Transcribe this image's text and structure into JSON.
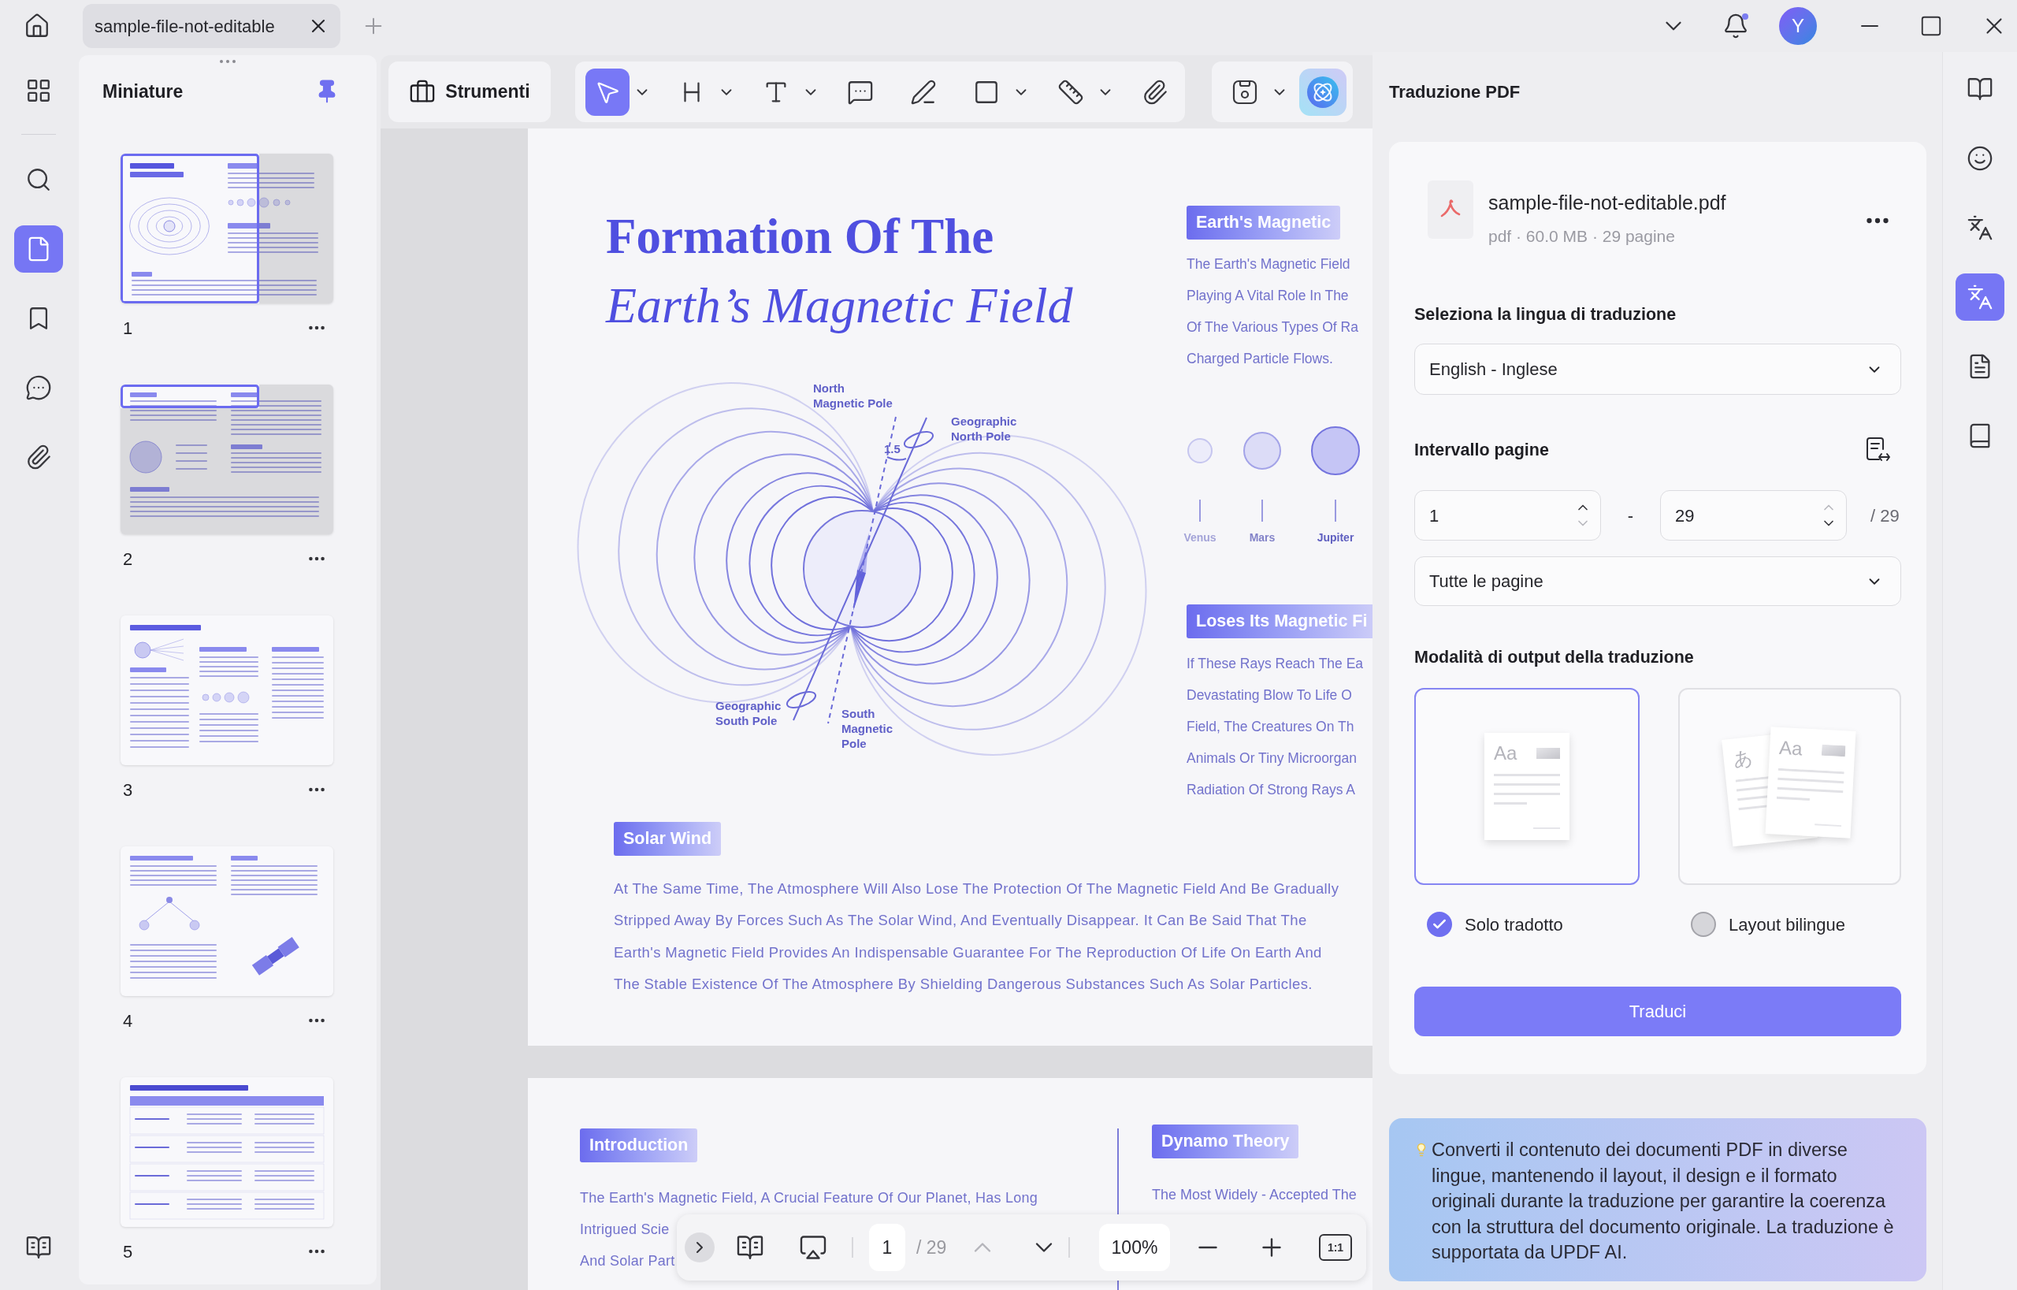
{
  "title_bar": {
    "tabs": [
      {
        "label": "sample-file-not-editable",
        "selected": true
      }
    ],
    "unread": true,
    "avatar_initial": "Y"
  },
  "left_rail": {
    "items": [
      {
        "selected": false
      },
      {
        "selected": false
      },
      {
        "selected": true
      },
      {
        "selected": false
      },
      {
        "selected": false
      },
      {
        "selected": false
      }
    ]
  },
  "thumbnails": {
    "title": "Miniature",
    "pinned": true,
    "pages": [
      {
        "number": "1",
        "kind": "cover",
        "in_view": true,
        "fully_in_view": true
      },
      {
        "number": "2",
        "kind": "columns",
        "in_view": true,
        "fully_in_view": false
      },
      {
        "number": "3",
        "kind": "theories",
        "in_view": false,
        "fully_in_view": false
      },
      {
        "number": "4",
        "kind": "satellite",
        "in_view": false,
        "fully_in_view": false
      },
      {
        "number": "5",
        "kind": "table",
        "in_view": false,
        "fully_in_view": false
      }
    ]
  },
  "toolbar": {
    "tools_label": "Strumenti",
    "tools": [
      {
        "selected": true,
        "dropdown": true
      },
      {
        "selected": false,
        "dropdown": true
      },
      {
        "selected": false,
        "dropdown": true
      },
      {
        "selected": false,
        "dropdown": false
      },
      {
        "selected": false,
        "dropdown": false
      },
      {
        "selected": false,
        "dropdown": true
      },
      {
        "selected": false,
        "dropdown": true
      },
      {
        "selected": false,
        "dropdown": false
      }
    ],
    "extra_tools": [
      {
        "dropdown": true
      },
      {
        "dropdown": false
      }
    ]
  },
  "document": {
    "page_1": {
      "title_lines": [
        "Formation Of The",
        "Earth’s Magnetic Field"
      ],
      "diagram_labels": [
        {
          "lines": [
            "North",
            "Magnetic Pole"
          ]
        },
        {
          "lines": [
            "Geographic",
            "North Pole"
          ]
        },
        {
          "lines": [
            "1.5"
          ]
        },
        {
          "lines": [
            "Geographic",
            "South Pole"
          ]
        },
        {
          "lines": [
            "South",
            "Magnetic",
            "Pole"
          ]
        }
      ],
      "side_sections": [
        {
          "heading": "Earth's Magnetic",
          "lines": [
            "The Earth's Magnetic Field",
            "Playing A Vital Role In The",
            "Of The Various Types Of Ra",
            "Charged Particle Flows."
          ]
        },
        {
          "heading": "Loses Its Magnetic Fi",
          "lines": [
            "If These Rays Reach The Ea",
            "Devastating Blow To Life O",
            "Field, The Creatures On Th",
            "Animals Or Tiny Microorgan",
            "Radiation Of Strong Rays A"
          ]
        }
      ],
      "planets": [
        "Venus",
        "Mars",
        "Jupiter"
      ],
      "solar_wind": {
        "heading": "Solar Wind",
        "text": "At The Same Time, The Atmosphere Will Also Lose The Protection Of The Magnetic Field And Be Gradually Stripped Away By Forces Such As The Solar Wind, And Eventually Disappear. It Can Be Said That The Earth's Magnetic Field Provides An Indispensable Guarantee For The Reproduction Of Life On Earth And The Stable Existence Of The Atmosphere By Shielding Dangerous Substances Such As Solar Particles."
      }
    },
    "page_2": {
      "sections": [
        {
          "heading": "Introduction",
          "lines": [
            "The Earth's Magnetic Field, A Crucial Feature Of Our Planet, Has Long",
            "Intrigued Scie",
            "And Solar Part"
          ]
        },
        {
          "heading": "Dynamo Theory",
          "lines": [
            "The Most Widely - Accepted The"
          ]
        }
      ]
    }
  },
  "bottom_toolbar": {
    "page": "1",
    "total": "/ 29",
    "prev_disabled": true,
    "next_disabled": false,
    "zoom": "100%",
    "actual_size": "1:1"
  },
  "translation_panel": {
    "title": "Traduzione PDF",
    "file": {
      "name": "sample-file-not-editable.pdf",
      "meta": "pdf · 60.0 MB · 29 pagine"
    },
    "language": {
      "label": "Seleziona la lingua di traduzione",
      "value": "English - Inglese"
    },
    "range": {
      "label": "Intervallo pagine",
      "from": {
        "value": "1",
        "up_disabled": false,
        "down_disabled": true
      },
      "separator": "-",
      "to": {
        "value": "29",
        "up_disabled": true,
        "down_disabled": false
      },
      "total": "/ 29",
      "preset": "Tutte le pagine"
    },
    "output": {
      "label": "Modalità di output della traduzione",
      "options": [
        {
          "label": "Solo tradotto",
          "selected": true,
          "kind": "single",
          "preview": [
            "Aa"
          ]
        },
        {
          "label": "Layout bilingue",
          "selected": false,
          "kind": "bilingual",
          "preview": [
            "あ",
            "Aa"
          ]
        }
      ]
    },
    "submit": "Traduci",
    "info": "Converti il contenuto dei documenti PDF in diverse lingue, mantenendo il layout, il design e il formato originali durante la traduzione per garantire la coerenza con la struttura del documento originale. La traduzione è supportata da UPDF AI."
  },
  "right_rail": {
    "items": [
      {
        "selected": false
      },
      {
        "selected": false
      },
      {
        "selected": false
      },
      {
        "selected": true
      },
      {
        "selected": false
      },
      {
        "selected": false
      }
    ]
  }
}
